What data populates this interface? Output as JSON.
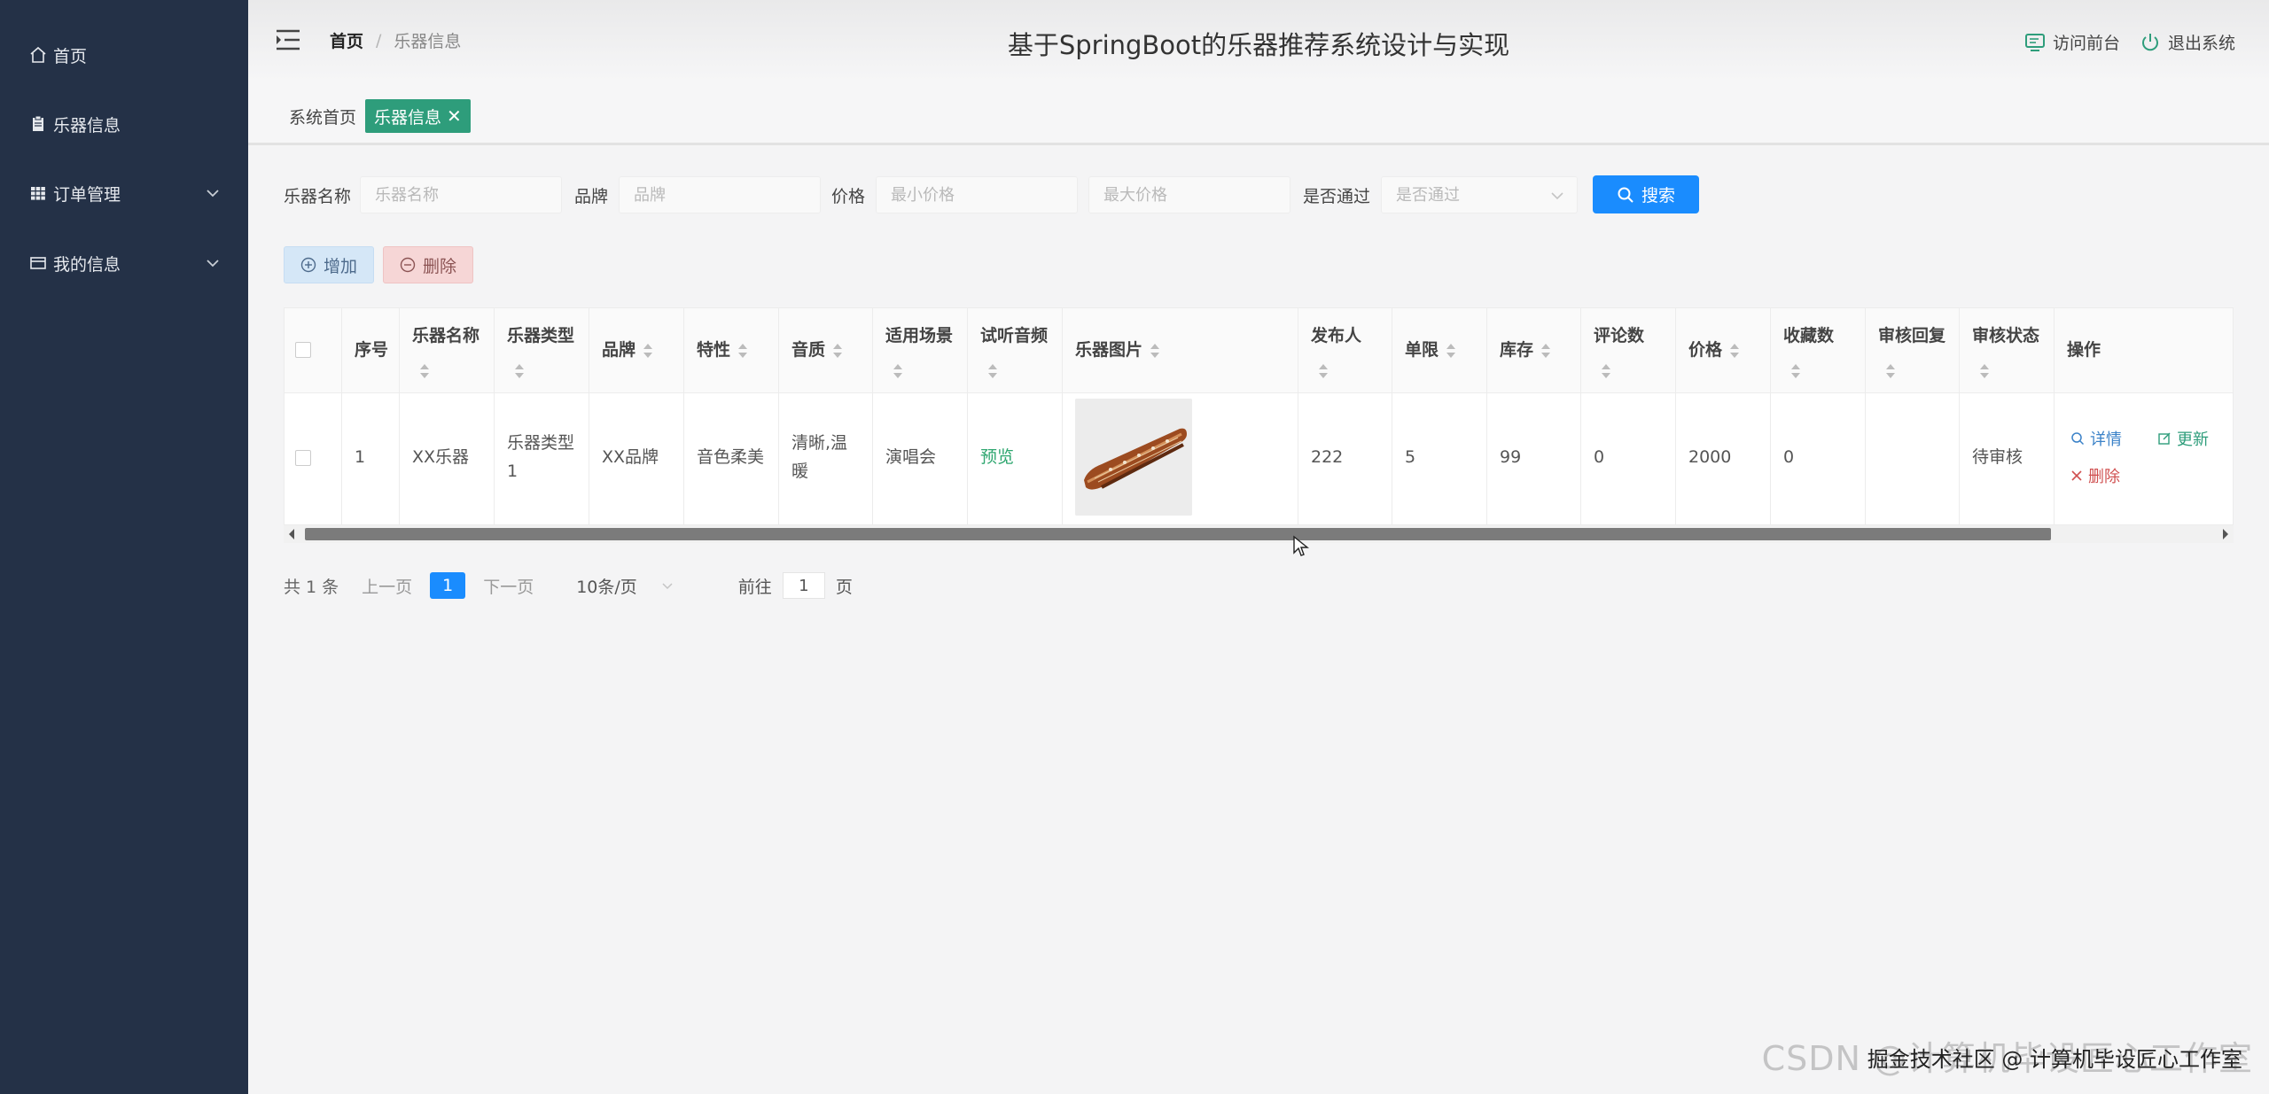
{
  "sidebar": {
    "items": [
      {
        "label": "首页",
        "icon": "home-icon"
      },
      {
        "label": "乐器信息",
        "icon": "clipboard-icon"
      },
      {
        "label": "订单管理",
        "icon": "grid-icon",
        "expandable": true
      },
      {
        "label": "我的信息",
        "icon": "card-icon",
        "expandable": true
      }
    ]
  },
  "header": {
    "breadcrumb_home": "首页",
    "breadcrumb_sep": "/",
    "breadcrumb_current": "乐器信息",
    "title": "基于SpringBoot的乐器推荐系统设计与实现",
    "visit_front": "访问前台",
    "logout": "退出系统"
  },
  "tags": {
    "home": "系统首页",
    "active": "乐器信息",
    "close": "✕"
  },
  "search": {
    "name_label": "乐器名称",
    "name_placeholder": "乐器名称",
    "brand_label": "品牌",
    "brand_placeholder": "品牌",
    "price_label": "价格",
    "min_price_placeholder": "最小价格",
    "max_price_placeholder": "最大价格",
    "approved_label": "是否通过",
    "approved_placeholder": "是否通过",
    "search_button": "搜索"
  },
  "actions": {
    "add": "增加",
    "delete": "删除"
  },
  "table": {
    "columns": [
      "序号",
      "乐器名称",
      "乐器类型",
      "品牌",
      "特性",
      "音质",
      "适用场景",
      "试听音频",
      "乐器图片",
      "发布人",
      "单限",
      "库存",
      "评论数",
      "价格",
      "收藏数",
      "审核回复",
      "审核状态",
      "操作"
    ],
    "rows": [
      {
        "index": "1",
        "name": "XX乐器",
        "type": "乐器类型1",
        "brand": "XX品牌",
        "feature": "音色柔美",
        "quality": "清晰,温暖",
        "scene": "演唱会",
        "audio": "预览",
        "publisher": "222",
        "limit": "5",
        "stock": "99",
        "comments": "0",
        "price": "2000",
        "favorites": "0",
        "reply": "",
        "status": "待审核",
        "op_detail": "详情",
        "op_update": "更新",
        "op_delete": "删除"
      }
    ]
  },
  "pagination": {
    "total": "共 1 条",
    "prev": "上一页",
    "current": "1",
    "next": "下一页",
    "page_size": "10条/页",
    "goto_label": "前往",
    "goto_value": "1",
    "page_suffix": "页"
  },
  "watermark": {
    "csdn": "CSDN @计算机毕设匠心工作室",
    "juejin": "掘金技术社区 @ 计算机毕设匠心工作室"
  },
  "colors": {
    "sidebar_bg": "#243147",
    "primary": "#1a8cfe",
    "tag_active": "#2e9d7b"
  }
}
